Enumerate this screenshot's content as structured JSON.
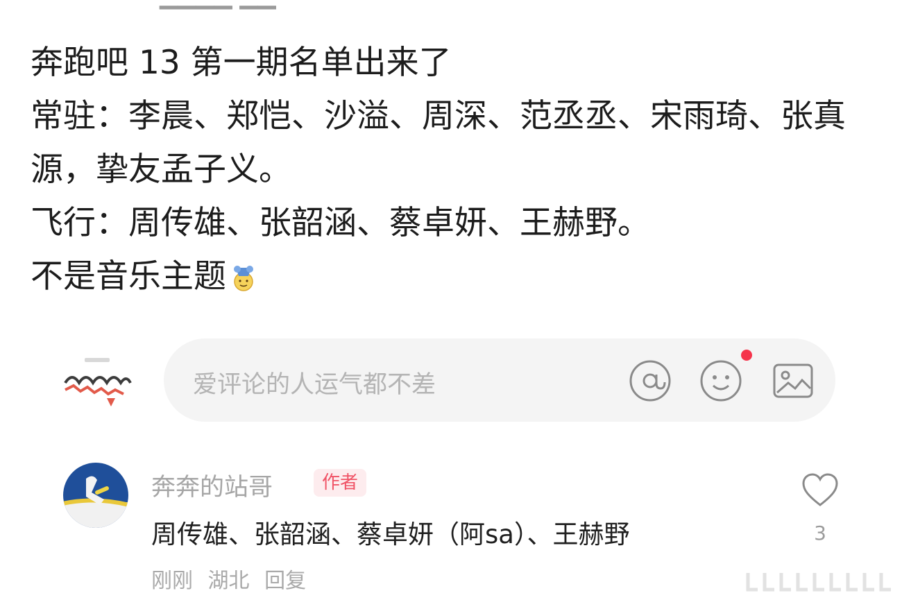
{
  "post": {
    "line1": "奔跑吧 13 第一期名单出来了",
    "regulars_line": "常驻：李晨、郑恺、沙溢、周深、范丞丞、宋雨琦、张真源，挚友孟子义。",
    "flying_line": "飞行：周传雄、张韶涵、蔡卓妍、王赫野。",
    "theme_line": "不是音乐主题",
    "emoji": "doge-emoji"
  },
  "comment_input": {
    "placeholder": "爱评论的人运气都不差",
    "icons": [
      "at-icon",
      "smile-icon",
      "image-icon"
    ],
    "notification_dot_color": "#f5334b"
  },
  "comment": {
    "author_name": "奔奔的站哥",
    "badge": "作者",
    "text": "周传雄、张韶涵、蔡卓妍（阿sa）、王赫野",
    "time": "刚刚",
    "location": "湖北",
    "reply_label": "回复",
    "like_count": "3"
  },
  "colors": {
    "accent": "#f05366",
    "badge_bg": "#fdecee",
    "muted_text": "#a6a6a6",
    "input_bg": "#f4f4f4"
  }
}
